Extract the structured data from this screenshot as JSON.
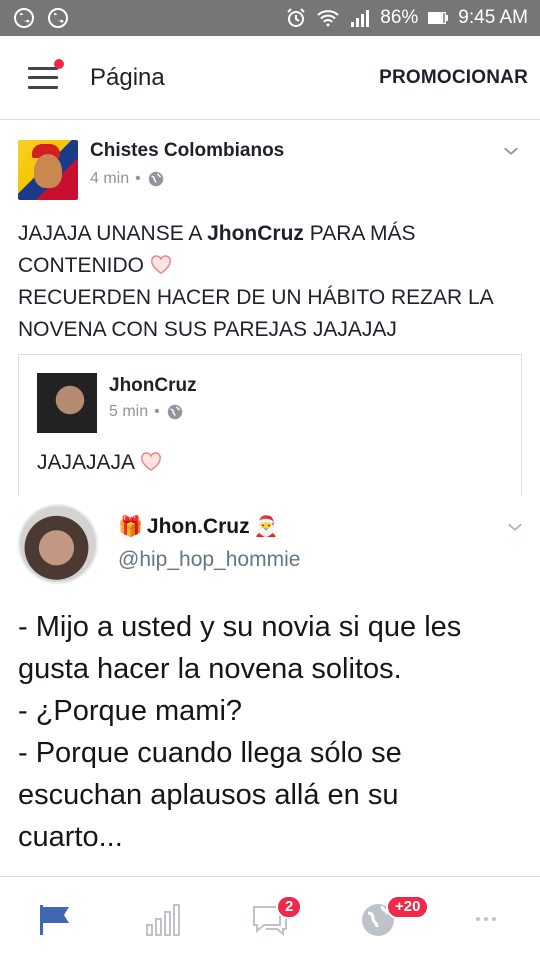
{
  "status_bar": {
    "battery": "86%",
    "time": "9:45 AM",
    "icons": [
      "whatsapp-icon",
      "whatsapp-icon",
      "alarm-icon",
      "wifi-icon",
      "signal-icon",
      "battery-icon"
    ]
  },
  "header": {
    "title": "Página",
    "action_label": "PROMOCIONAR",
    "menu_icon": "hamburger-menu-icon"
  },
  "post": {
    "author": "Chistes Colombianos",
    "time": "4 min",
    "privacy_separator": "•",
    "text_line1_prefix": "JAJAJA UNANSE A ",
    "text_line1_bold": "JhonCruz",
    "text_line1_suffix": " PARA MÁS",
    "text_line2": "CONTENIDO",
    "text_line3": "RECUERDEN HACER DE UN HÁBITO REZAR LA",
    "text_line4": "NOVENA CON SUS PAREJAS JAJAJAJ",
    "shared": {
      "author": "JhonCruz",
      "time": "5 min",
      "privacy_separator": "•",
      "text": "JAJAJAJA"
    }
  },
  "tweet": {
    "name": "Jhon.Cruz",
    "handle": "@hip_hop_hommie",
    "lines": [
      "- Mijo a usted y su novia si que les",
      "gusta hacer la novena solitos.",
      "- ¿Porque mami?",
      "- Porque cuando llega sólo se",
      "escuchan aplausos allá en su",
      "cuarto..."
    ]
  },
  "bottom_nav": {
    "items": [
      {
        "icon": "flag-icon",
        "active": true
      },
      {
        "icon": "insights-bars-icon"
      },
      {
        "icon": "messages-icon",
        "badge": "2"
      },
      {
        "icon": "globe-notifications-icon",
        "badge": "+20"
      },
      {
        "icon": "more-dots-icon"
      }
    ]
  },
  "colors": {
    "accent": "#4267b2",
    "badge": "#f02849",
    "status_bar": "#767676",
    "muted": "#90949c"
  }
}
